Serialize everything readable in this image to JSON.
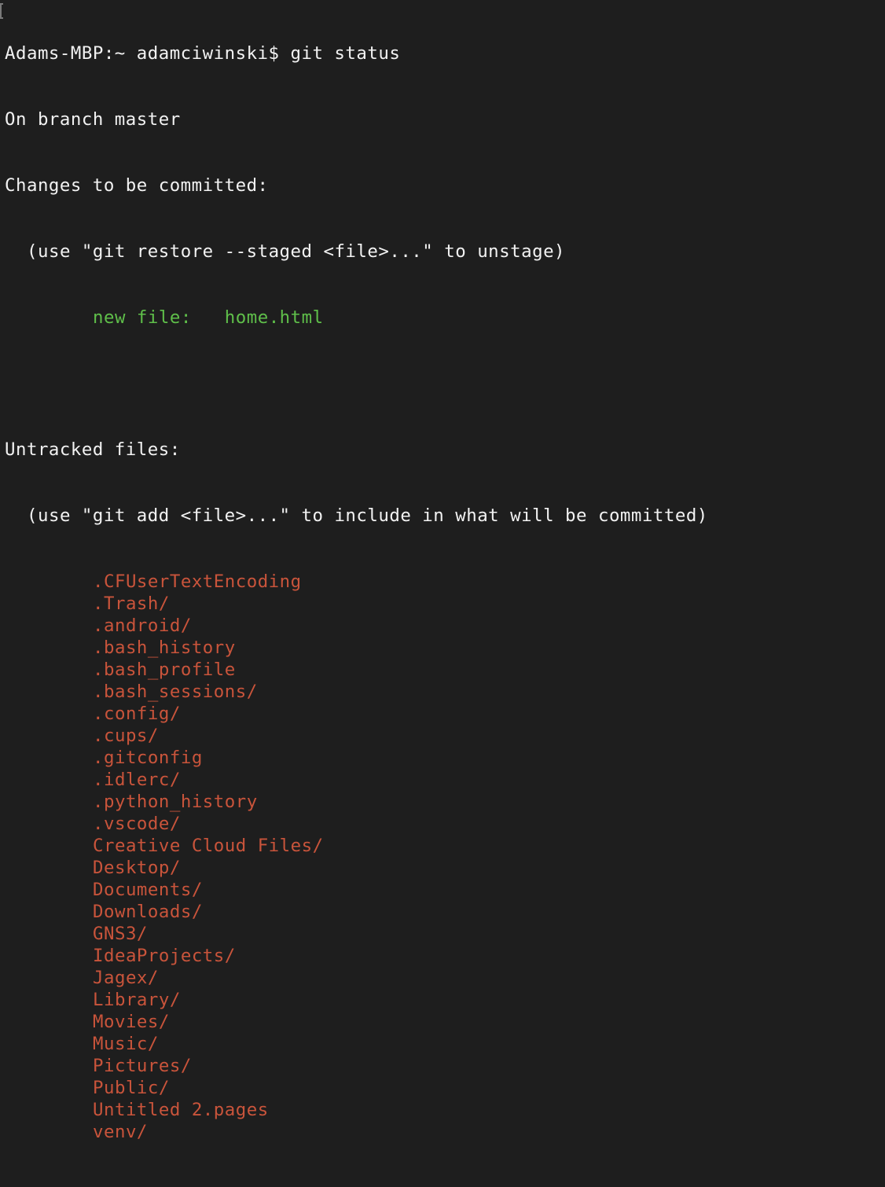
{
  "terminal": {
    "prompt": "Adams-MBP:~ adamciwinski$ ",
    "command": "git status",
    "branch_line": "On branch master",
    "staged_header": "Changes to be committed:",
    "staged_hint": "(use \"git restore --staged <file>...\" to unstage)",
    "staged_files": [
      {
        "status": "new file:",
        "gap": "   ",
        "name": "home.html"
      }
    ],
    "untracked_header": "Untracked files:",
    "untracked_hint": "(use \"git add <file>...\" to include in what will be committed)",
    "untracked_files": [
      ".CFUserTextEncoding",
      ".Trash/",
      ".android/",
      ".bash_history",
      ".bash_profile",
      ".bash_sessions/",
      ".config/",
      ".cups/",
      ".gitconfig",
      ".idlerc/",
      ".python_history",
      ".vscode/",
      "Creative Cloud Files/",
      "Desktop/",
      "Documents/",
      "Downloads/",
      "GNS3/",
      "IdeaProjects/",
      "Jagex/",
      "Library/",
      "Movies/",
      "Music/",
      "Pictures/",
      "Public/",
      "Untitled 2.pages",
      "venv/"
    ]
  },
  "colors": {
    "background": "#1e1e1e",
    "text": "#f2f2f2",
    "staged": "#5fbf4a",
    "untracked": "#c9543b"
  }
}
